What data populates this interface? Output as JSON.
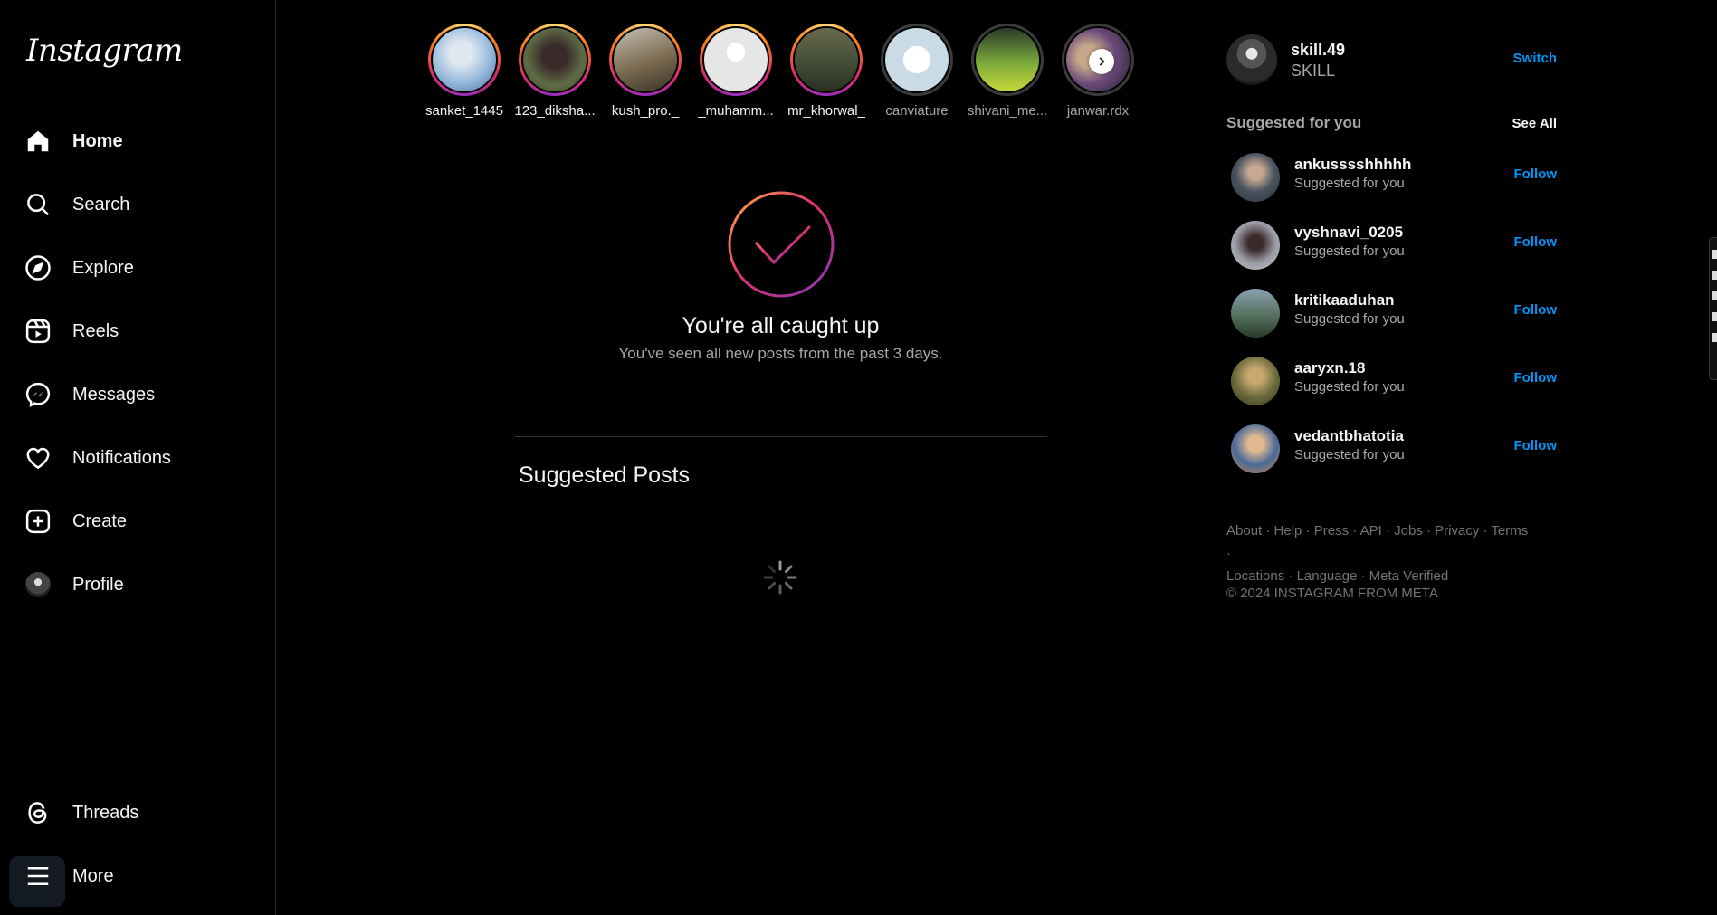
{
  "brand": {
    "logo_text": "Instagram"
  },
  "nav": {
    "home": "Home",
    "search": "Search",
    "explore": "Explore",
    "reels": "Reels",
    "messages": "Messages",
    "notifications": "Notifications",
    "create": "Create",
    "profile": "Profile",
    "threads": "Threads",
    "more": "More"
  },
  "stories": [
    {
      "username": "sanket_1445",
      "seen": false,
      "color": "#8fb4d9"
    },
    {
      "username": "123_diksha...",
      "seen": false,
      "color": "#5f6b45"
    },
    {
      "username": "kush_pro._",
      "seen": false,
      "color": "#7a6a50"
    },
    {
      "username": "_muhamm...",
      "seen": false,
      "color": "#e6e6e6"
    },
    {
      "username": "mr_khorwal_",
      "seen": false,
      "color": "#46503a"
    },
    {
      "username": "canviature",
      "seen": true,
      "color": "#c9dbe6"
    },
    {
      "username": "shivani_me...",
      "seen": true,
      "color": "#7aa93a"
    },
    {
      "username": "janwar.rdx",
      "seen": true,
      "color": "#6b4a7a"
    }
  ],
  "feed": {
    "caught_up_title": "You're all caught up",
    "caught_up_subtitle": "You've seen all new posts from the past 3 days.",
    "suggested_posts_heading": "Suggested Posts"
  },
  "account": {
    "username": "skill.49",
    "full_name": "SKILL",
    "switch_label": "Switch"
  },
  "suggestions": {
    "heading": "Suggested for you",
    "see_all_label": "See All",
    "items": [
      {
        "username": "ankusssshhhhh",
        "subtitle": "Suggested for you",
        "action": "Follow",
        "color": "#4a5560"
      },
      {
        "username": "vyshnavi_0205",
        "subtitle": "Suggested for you",
        "action": "Follow",
        "color": "#9a9aa4"
      },
      {
        "username": "kritikaaduhan",
        "subtitle": "Suggested for you",
        "action": "Follow",
        "color": "#55705e"
      },
      {
        "username": "aaryxn.18",
        "subtitle": "Suggested for you",
        "action": "Follow",
        "color": "#6a6a3a"
      },
      {
        "username": "vedantbhatotia",
        "subtitle": "Suggested for you",
        "action": "Follow",
        "color": "#4a6a9a"
      }
    ]
  },
  "footer": {
    "links": [
      "About",
      "Help",
      "Press",
      "API",
      "Jobs",
      "Privacy",
      "Terms",
      "Locations",
      "Language",
      "Meta Verified"
    ],
    "copyright": "© 2024 INSTAGRAM FROM META"
  },
  "colors": {
    "accent_blue": "#0095f6",
    "background": "#000000",
    "muted_text": "#a8a8a8"
  }
}
